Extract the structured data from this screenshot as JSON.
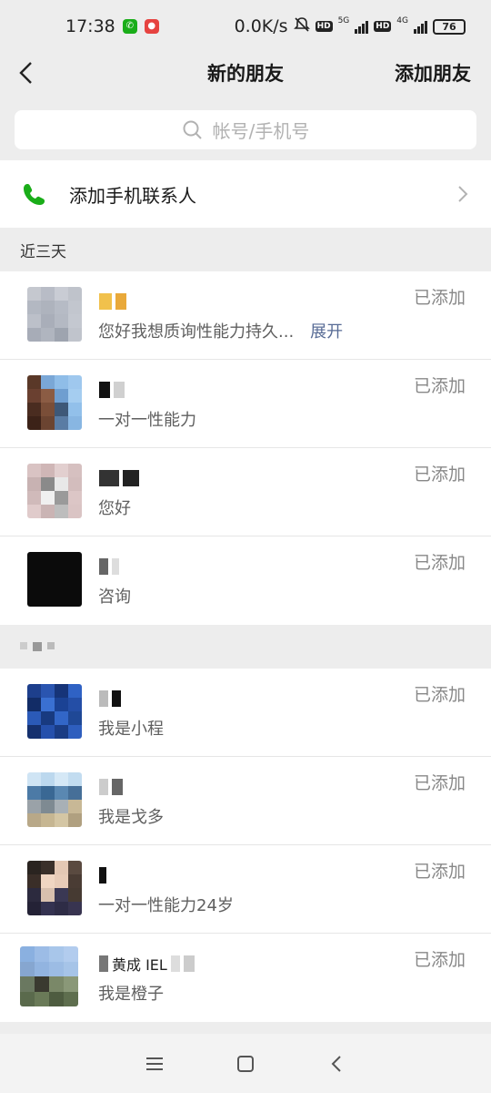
{
  "status_bar": {
    "time": "17:38",
    "speed": "0.0K/s",
    "net1": "5G",
    "net2": "4G",
    "hd": "HD",
    "battery": "76"
  },
  "nav": {
    "title": "新的朋友",
    "action": "添加朋友"
  },
  "search": {
    "placeholder": "帐号/手机号"
  },
  "phone_contacts": {
    "label": "添加手机联系人"
  },
  "sections": [
    {
      "title": "近三天",
      "items": [
        {
          "message": "您好我想质询性能力持久...",
          "expand": "展开",
          "status": "已添加"
        },
        {
          "message": "一对一性能力",
          "status": "已添加"
        },
        {
          "message": "您好",
          "status": "已添加"
        },
        {
          "message": "咨询",
          "status": "已添加"
        }
      ]
    },
    {
      "title": "",
      "items": [
        {
          "message": "我是小程",
          "status": "已添加"
        },
        {
          "message": "我是戈多",
          "status": "已添加"
        },
        {
          "message": "一对一性能力24岁",
          "status": "已添加"
        },
        {
          "name": "黄成 IEL",
          "message": "我是橙子",
          "status": "已添加"
        }
      ]
    }
  ],
  "colors": {
    "accent_green": "#1aad19",
    "link_blue": "#576b95",
    "background": "#ededed"
  }
}
